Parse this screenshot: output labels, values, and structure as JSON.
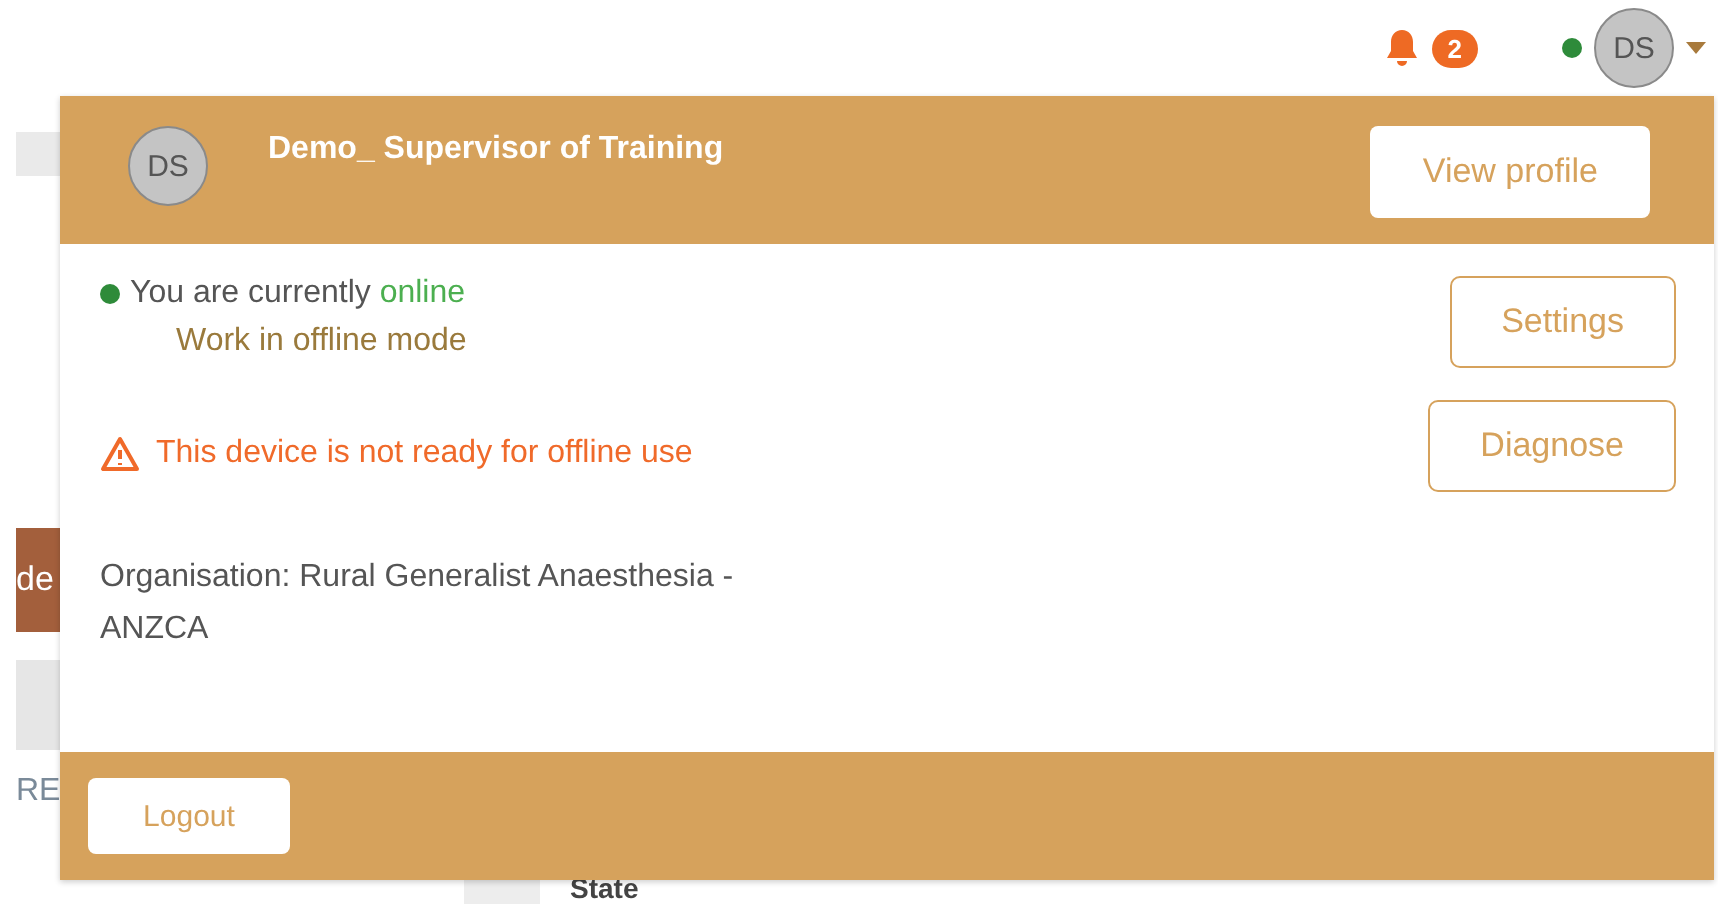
{
  "topbar": {
    "notification_count": "2",
    "user_initials": "DS",
    "user_online": true
  },
  "background": {
    "tab_fragment": "de",
    "label_fragment": "RE",
    "column_heading": "State"
  },
  "profile_menu": {
    "avatar_initials": "DS",
    "name": "Demo_ Supervisor of Training",
    "view_profile_button": "View profile",
    "status": {
      "online": true,
      "prefix": "You are currently",
      "state_text": "online"
    },
    "offline_mode_link": "Work in offline mode",
    "settings_button": "Settings",
    "warning": "This device is not ready for offline use",
    "diagnose_button": "Diagnose",
    "organisation": "Organisation: Rural Generalist Anaesthesia - ANZCA",
    "logout_button": "Logout"
  }
}
